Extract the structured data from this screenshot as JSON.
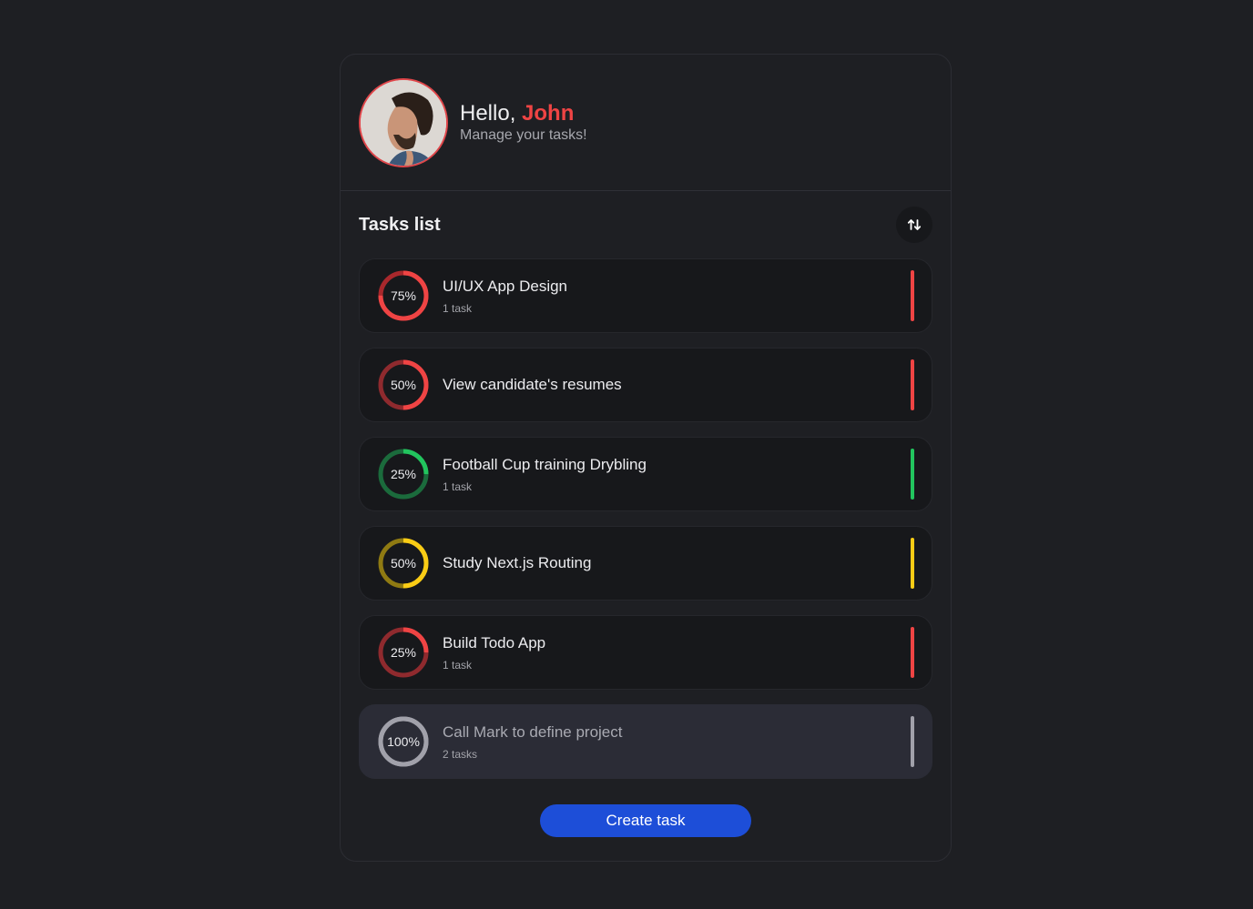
{
  "header": {
    "greeting": "Hello,",
    "name": "John",
    "subtitle": "Manage your tasks!"
  },
  "list": {
    "title": "Tasks list",
    "sort_icon": "sort-arrows-icon"
  },
  "tasks": [
    {
      "title": "UI/UX App Design",
      "count": "1 task",
      "percent_label": "75%",
      "progress": 0.75,
      "color": "#ef4444",
      "track": "#a8282c",
      "bar": "#ef4444",
      "done": false
    },
    {
      "title": "View candidate's resumes",
      "count": "",
      "percent_label": "50%",
      "progress": 0.5,
      "color": "#ef4444",
      "track": "#8f2a2e",
      "bar": "#ef4444",
      "done": false
    },
    {
      "title": "Football Cup training Drybling",
      "count": "1 task",
      "percent_label": "25%",
      "progress": 0.25,
      "color": "#22c55e",
      "track": "#1b6b3c",
      "bar": "#22c55e",
      "done": false
    },
    {
      "title": "Study Next.js Routing",
      "count": "",
      "percent_label": "50%",
      "progress": 0.5,
      "color": "#facc15",
      "track": "#8f7a12",
      "bar": "#facc15",
      "done": false
    },
    {
      "title": "Build Todo App",
      "count": "1 task",
      "percent_label": "25%",
      "progress": 0.25,
      "color": "#ef4444",
      "track": "#8f2a2e",
      "bar": "#ef4444",
      "done": false
    },
    {
      "title": "Call Mark to define project",
      "count": "2 tasks",
      "percent_label": "100%",
      "progress": 1.0,
      "color": "#a1a1aa",
      "track": "#a1a1aa",
      "bar": "#a1a1aa",
      "done": true
    }
  ],
  "footer": {
    "create_label": "Create task"
  }
}
